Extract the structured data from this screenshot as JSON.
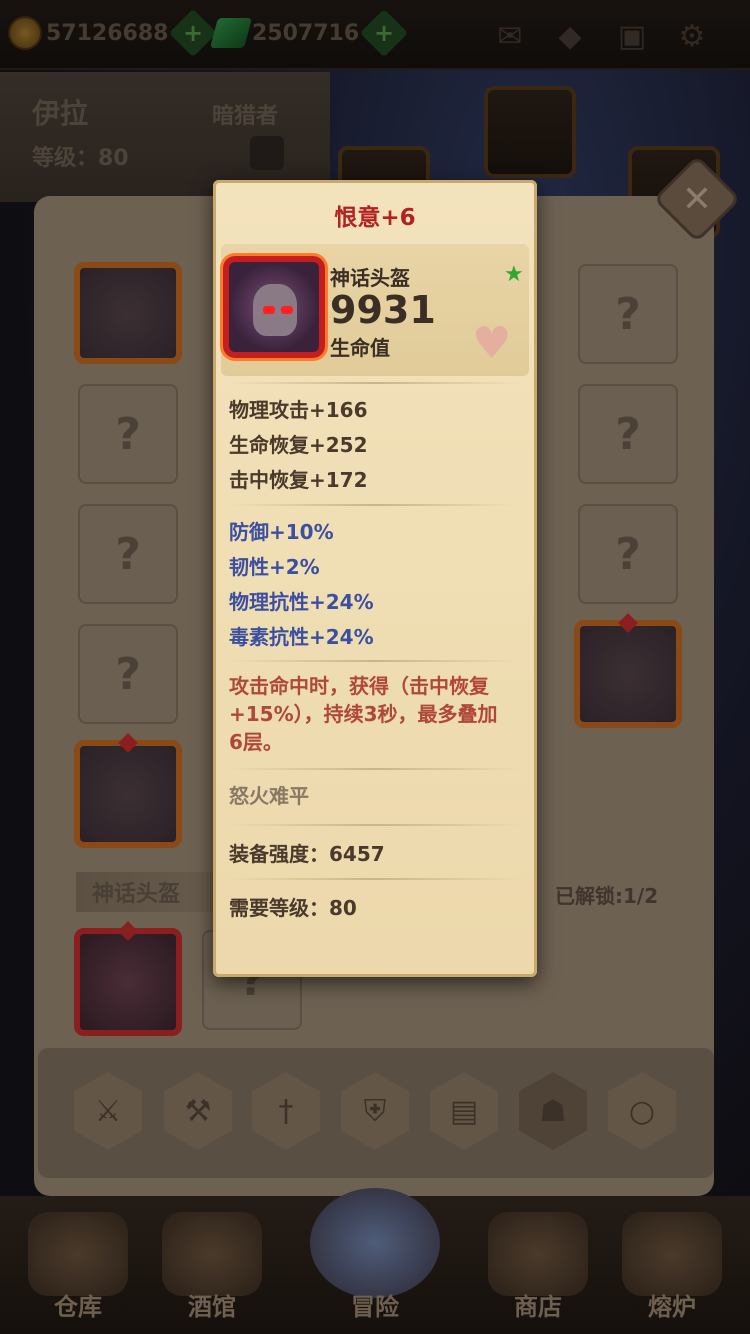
{
  "topbar": {
    "gold": "57126688",
    "gems": "2507716"
  },
  "hero": {
    "name": "伊拉",
    "level_label": "等级：80",
    "class": "暗猎者"
  },
  "inventory": {
    "slot_placeholder": "?",
    "section_label": "神话头盔",
    "unlock_label": "已解锁:1/2"
  },
  "tooltip": {
    "title": "恨意+6",
    "item_type": "神话头盔",
    "main_value": "9931",
    "main_stat": "生命值",
    "base_stats": [
      "物理攻击+166",
      "生命恢复+252",
      "击中恢复+172"
    ],
    "bonus_stats": [
      "防御+10%",
      "韧性+2%",
      "物理抗性+24%",
      "毒素抗性+24%"
    ],
    "effect_line1": "攻击命中时，获得（击中恢复",
    "effect_line2": "+15%），持续3秒，最多叠加",
    "effect_line3": "6层。",
    "flavor": "怒火难平",
    "gear_score": "装备强度：6457",
    "required_level": "需要等级：80"
  },
  "toolbar": {
    "icons": [
      "weapon-icon",
      "mace-icon",
      "sword-icon",
      "shield-icon",
      "book-icon",
      "helmet-icon",
      "mirror-icon"
    ]
  },
  "bottom_nav": [
    {
      "label": "仓库"
    },
    {
      "label": "酒馆"
    },
    {
      "label": "冒险"
    },
    {
      "label": "商店"
    },
    {
      "label": "熔炉"
    }
  ],
  "colors": {
    "title_red": "#b32222",
    "bonus_blue": "#3c4fa0",
    "effect_red": "#b0483a",
    "parchment": "#f3e3bc"
  }
}
